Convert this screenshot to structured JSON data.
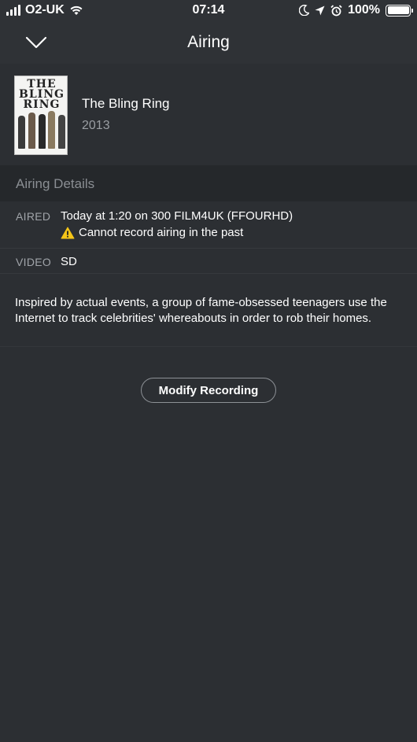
{
  "status_bar": {
    "carrier": "O2-UK",
    "time": "07:14",
    "battery": "100%",
    "icons": [
      "signal-icon",
      "wifi-icon",
      "moon-icon",
      "location-icon",
      "alarm-icon",
      "battery-icon"
    ]
  },
  "nav": {
    "title": "Airing",
    "back_icon": "chevron-down-icon"
  },
  "movie": {
    "poster_text": "THE BLING RING",
    "title": "The Bling Ring",
    "year": "2013"
  },
  "section": {
    "title": "Airing Details"
  },
  "details": {
    "aired_label": "AIRED",
    "aired_value": "Today at 1:20 on 300 FILM4UK (FFOURHD)",
    "aired_warning": "Cannot record airing in the past",
    "video_label": "VIDEO",
    "video_value": "SD"
  },
  "description": "Inspired by actual events, a group of fame-obsessed teenagers use the Internet to track celebrities' whereabouts in order to rob their homes.",
  "actions": {
    "modify_label": "Modify Recording"
  },
  "colors": {
    "background": "#2c2f33",
    "bar": "#2f3236",
    "section_header": "#25282b",
    "muted_text": "#9a9ea3",
    "warning": "#f5c518"
  }
}
